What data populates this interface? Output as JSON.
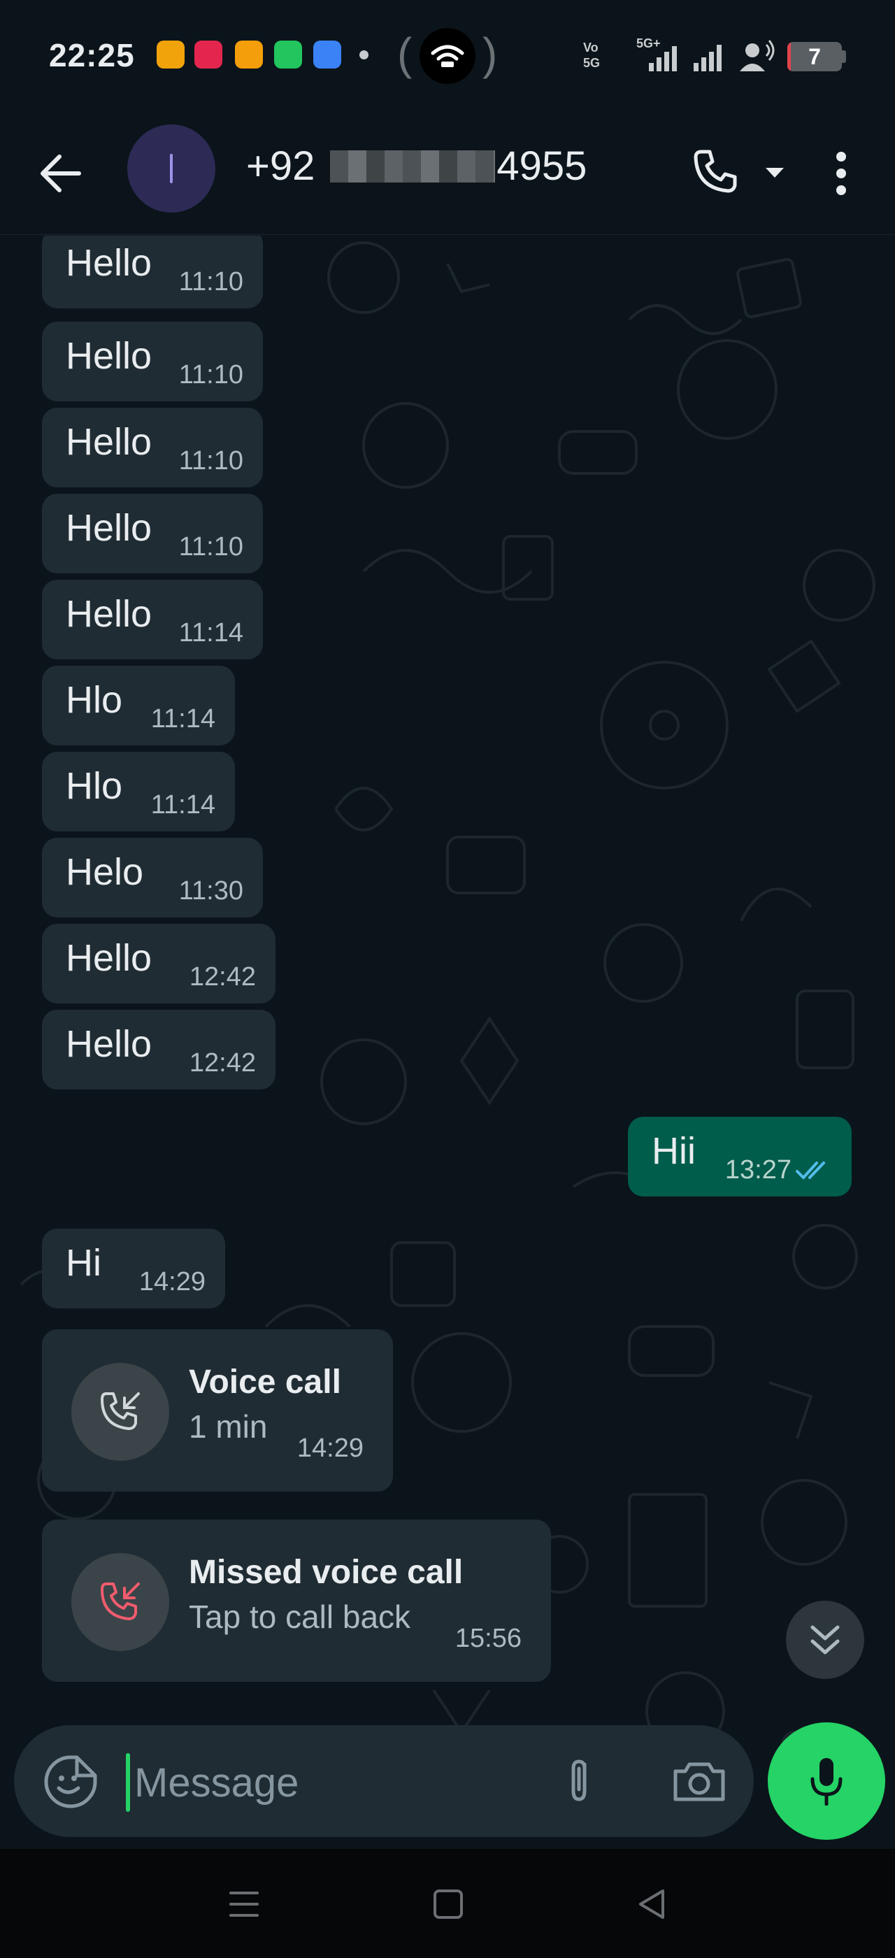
{
  "status_bar": {
    "time": "22:25",
    "network_label": "Vo 5G",
    "network_sub": "5G+",
    "battery_level": "7",
    "battery_fraction": 0.07,
    "battery_color": "#e0444b",
    "notification_icons": [
      "app-icon-orange",
      "snapchat-icon",
      "gallery-icon",
      "calendar-icon",
      "files-icon"
    ]
  },
  "header": {
    "contact_prefix": "+92",
    "contact_suffix": "4955",
    "back_icon": "arrow-left-icon",
    "call_icon": "phone-icon",
    "menu_icon": "more-vertical-icon"
  },
  "messages": [
    {
      "text": "Hello",
      "time": "11:10"
    },
    {
      "text": "Hello",
      "time": "11:10"
    },
    {
      "text": "Hello",
      "time": "11:10"
    },
    {
      "text": "Hello",
      "time": "11:10"
    },
    {
      "text": "Hello",
      "time": "11:14"
    },
    {
      "text": "Hlo",
      "time": "11:14"
    },
    {
      "text": "Hlo",
      "time": "11:14"
    },
    {
      "text": "Helo",
      "time": "11:30"
    },
    {
      "text": "Hello",
      "time": "12:42"
    },
    {
      "text": "Hello",
      "time": "12:42"
    }
  ],
  "outgoing": {
    "text": "Hii",
    "time": "13:27",
    "status": "read"
  },
  "incoming_hi": {
    "text": "Hi",
    "time": "14:29"
  },
  "voice_call": {
    "title": "Voice call",
    "subtitle": "1 min",
    "time": "14:29"
  },
  "missed_call": {
    "title": "Missed voice call",
    "subtitle": "Tap to call back",
    "time": "15:56",
    "color": "#f15c6d"
  },
  "composer": {
    "placeholder": "Message"
  },
  "colors": {
    "background": "#0b141a",
    "incoming_bubble": "#202c33",
    "outgoing_bubble": "#005c4b",
    "accent": "#25d366",
    "read_ticks": "#53bdeb"
  }
}
